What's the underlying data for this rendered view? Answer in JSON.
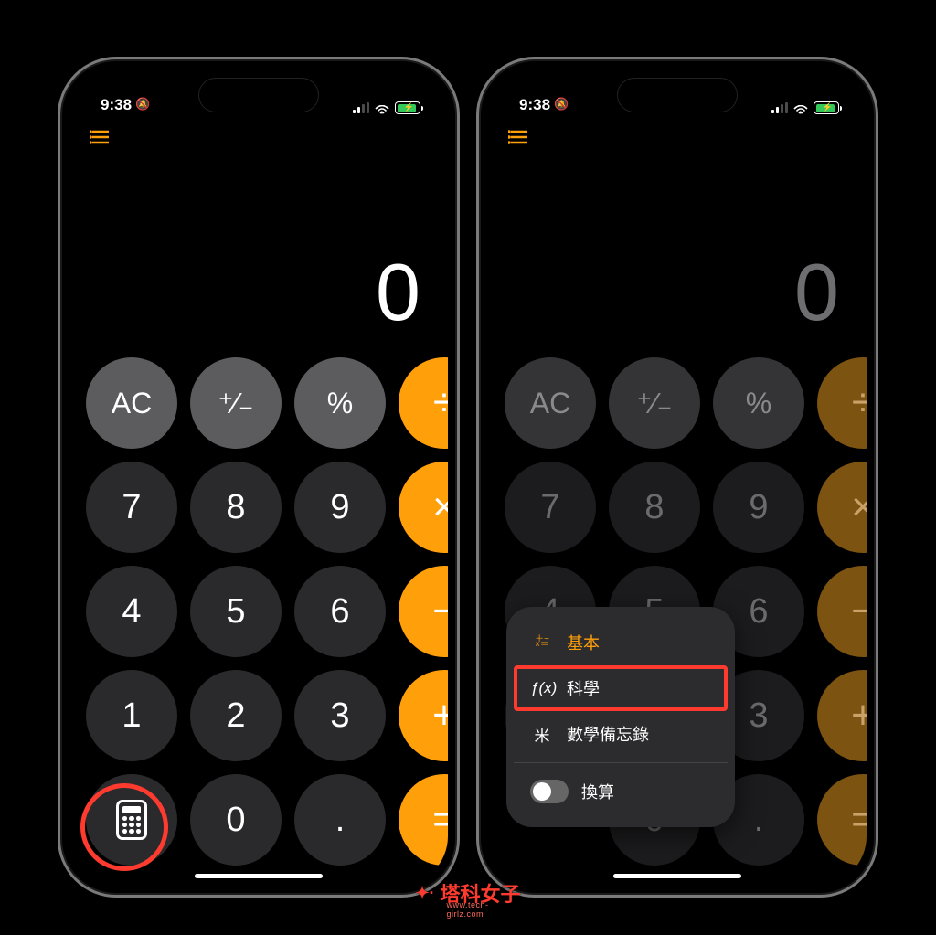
{
  "status": {
    "time": "9:38",
    "wifi": true,
    "charging": true
  },
  "calc": {
    "display": "0",
    "keys": {
      "ac": "AC",
      "sign": "⁺∕₋",
      "percent": "%",
      "divide": "÷",
      "seven": "7",
      "eight": "8",
      "nine": "9",
      "multiply": "×",
      "four": "4",
      "five": "5",
      "six": "6",
      "minus": "−",
      "one": "1",
      "two": "2",
      "three": "3",
      "plus": "+",
      "zero": "0",
      "dot": ".",
      "equals": "="
    }
  },
  "menu": {
    "basic": "基本",
    "basic_icon": "＋−\n×＝",
    "scientific": "科學",
    "scientific_icon": "ƒ(x)",
    "math_notes": "數學備忘錄",
    "math_notes_icon": "米",
    "convert": "換算"
  },
  "watermark": {
    "title": "塔科女子",
    "subtitle": "www.tech-girlz.com"
  }
}
